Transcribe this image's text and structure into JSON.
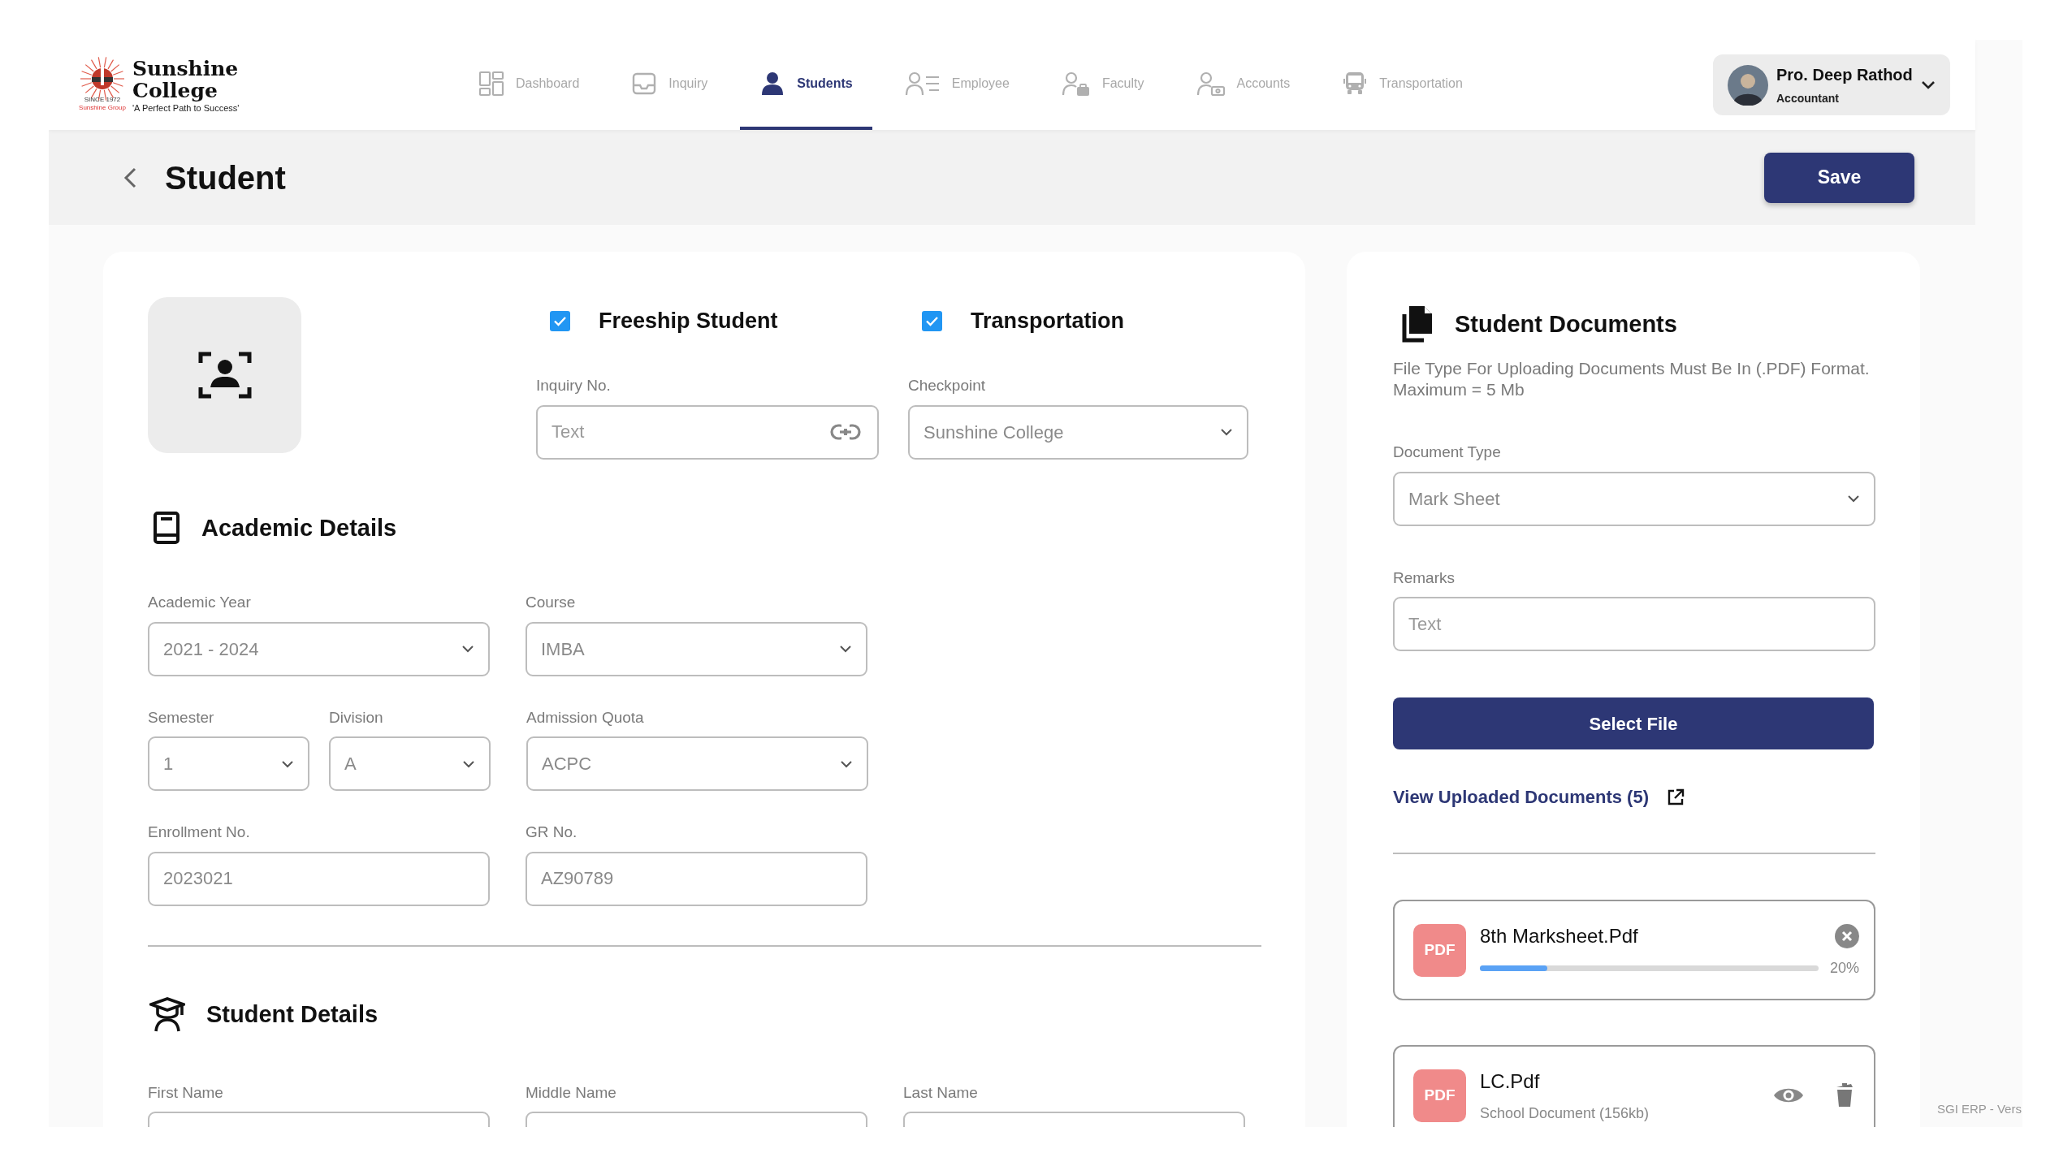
{
  "header": {
    "logo": {
      "name_lines": [
        "Sunshine",
        "College"
      ],
      "tagline": "'A Perfect Path to Success'",
      "emblem_texts": [
        "SINCE 1972",
        "Sunshine Group"
      ]
    },
    "nav": [
      {
        "label": "Dashboard",
        "selected": false
      },
      {
        "label": "Inquiry",
        "selected": false
      },
      {
        "label": "Students",
        "selected": true
      },
      {
        "label": "Employee",
        "selected": false
      },
      {
        "label": "Faculty",
        "selected": false
      },
      {
        "label": "Accounts",
        "selected": false
      },
      {
        "label": "Transportation",
        "selected": false
      }
    ],
    "user": {
      "name": "Pro. Deep Rathod",
      "role": "Accountant"
    }
  },
  "page_title": "Student",
  "save_button": "Save",
  "student_form": {
    "options": [
      {
        "label": "Freeship Student",
        "checked": true
      },
      {
        "label": "Transportation",
        "checked": true
      }
    ],
    "top_fields": [
      {
        "label": "Inquiry No.",
        "kind": "link",
        "placeholder": "Text"
      },
      {
        "label": "Checkpoint",
        "kind": "select",
        "value": "Sunshine College"
      }
    ],
    "sections": [
      {
        "title": "Academic Details",
        "rows": [
          [
            {
              "label": "Academic Year",
              "kind": "select",
              "value": "2021 - 2024"
            },
            {
              "label": "Course",
              "kind": "select",
              "value": "IMBA"
            }
          ],
          [
            {
              "label": "Semester",
              "kind": "select",
              "value": "1"
            },
            {
              "label": "Division",
              "kind": "select",
              "value": "A"
            },
            {
              "label": "Admission Quota",
              "kind": "select",
              "value": "ACPC"
            }
          ],
          [
            {
              "label": "Enrollment No.",
              "kind": "text",
              "value": "2023021"
            },
            {
              "label": "GR No.",
              "kind": "text",
              "value": "AZ90789"
            }
          ]
        ]
      },
      {
        "title": "Student Details",
        "rows": [
          [
            {
              "label": "First Name",
              "kind": "text"
            },
            {
              "label": "Middle Name",
              "kind": "text"
            },
            {
              "label": "Last Name",
              "kind": "text"
            }
          ]
        ]
      }
    ]
  },
  "documents": {
    "title": "Student Documents",
    "notes": [
      "File Type For Uploading Documents Must Be In (.PDF) Format.",
      "Maximum = 5 Mb"
    ],
    "fields": [
      {
        "label": "Document Type",
        "kind": "select",
        "value": "Mark Sheet"
      },
      {
        "label": "Remarks",
        "kind": "text",
        "placeholder": "Text"
      }
    ],
    "select_button": "Select File",
    "view_link": "View Uploaded Documents (5)",
    "files": [
      {
        "kind": "uploading",
        "badge": "PDF",
        "name": "8th Marksheet.Pdf",
        "level": 0.2,
        "reading": "20%"
      },
      {
        "kind": "uploaded",
        "badge": "PDF",
        "name": "LC.Pdf",
        "detail": "School Document (156kb)"
      }
    ]
  },
  "footer": "SGI ERP - Vers"
}
